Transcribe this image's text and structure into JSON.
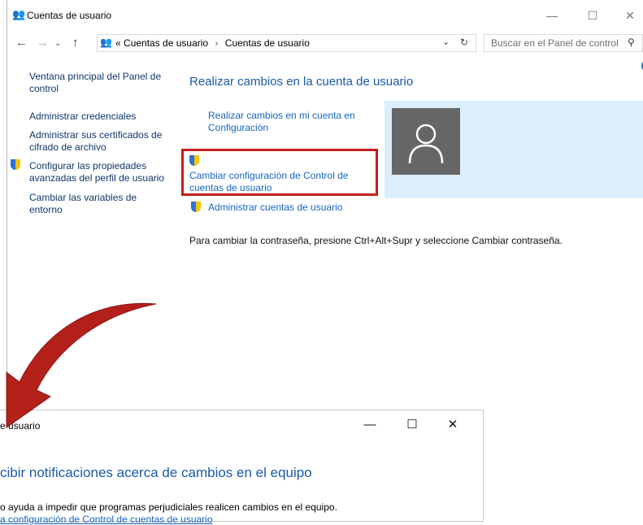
{
  "window": {
    "title": "Cuentas de usuario",
    "controls": {
      "minimize": "—",
      "maximize": "☐",
      "close": "✕"
    }
  },
  "address": {
    "breadcrumb_prefix": "«",
    "breadcrumb": [
      "Cuentas de usuario",
      "Cuentas de usuario"
    ],
    "separator": "›",
    "search_placeholder": "Buscar en el Panel de control"
  },
  "sidebar": {
    "items": [
      {
        "label": "Ventana principal del Panel de control"
      },
      {
        "label": "Administrar credenciales"
      },
      {
        "label": "Administrar sus certificados de cifrado de archivo"
      },
      {
        "label": "Configurar las propiedades avanzadas del perfil de usuario"
      },
      {
        "label": "Cambiar las variables de entorno"
      }
    ]
  },
  "main": {
    "heading": "Realizar cambios en la cuenta de usuario",
    "links": {
      "settings": "Realizar cambios en mi cuenta en Configuración",
      "uac": "Cambiar configuración de Control de cuentas de usuario",
      "manage": "Administrar cuentas de usuario"
    },
    "password_note": "Para cambiar la contraseña, presione Ctrl+Alt+Supr y seleccione Cambiar contraseña."
  },
  "second_window": {
    "title": "e usuario",
    "heading": "cibir notificaciones acerca de cambios en el equipo",
    "description": "o ayuda a impedir que programas perjudiciales realicen cambios en el equipo.",
    "link": "a configuración de Control de cuentas de usuario"
  },
  "colors": {
    "highlight": "#c2201c",
    "arrow": "#b3201a",
    "link": "#1565c0",
    "panel": "#dceefb"
  }
}
